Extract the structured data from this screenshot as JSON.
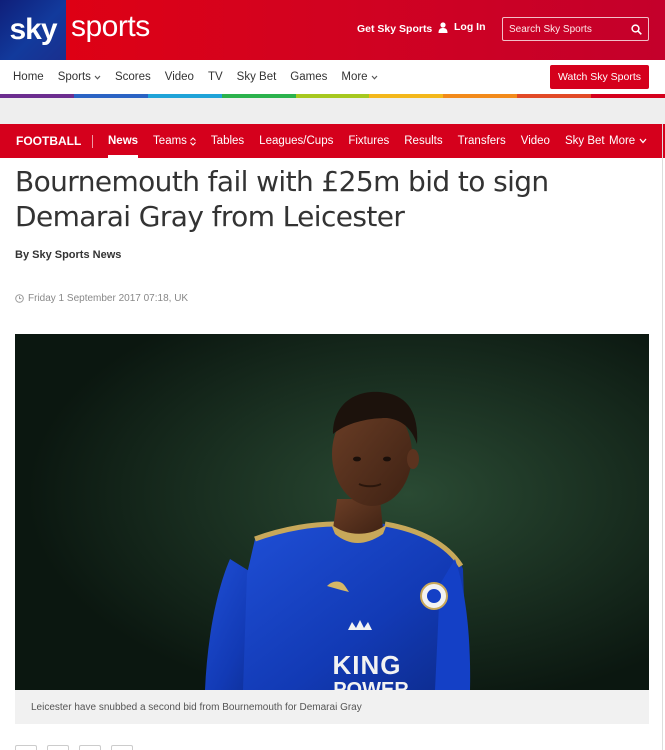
{
  "brand": {
    "logo_text": "sky",
    "section_text": "sports",
    "colors": {
      "red": "#d5001c",
      "blue": "#123a9c"
    }
  },
  "header": {
    "get_sky_label": "Get Sky Sports",
    "login_label": "Log In",
    "search_placeholder": "Search Sky Sports"
  },
  "mainnav": {
    "items": [
      {
        "label": "Home"
      },
      {
        "label": "Sports",
        "dropdown": true
      },
      {
        "label": "Scores"
      },
      {
        "label": "Video"
      },
      {
        "label": "TV"
      },
      {
        "label": "Sky Bet"
      },
      {
        "label": "Games"
      },
      {
        "label": "More",
        "dropdown": true
      }
    ],
    "watch_label": "Watch Sky Sports",
    "rainbow_colors": [
      "#6c2d8f",
      "#2a63c4",
      "#1fa3d8",
      "#2bb24c",
      "#a6c81f",
      "#f3b71b",
      "#f28a1b",
      "#e24a27",
      "#d5001c"
    ]
  },
  "subnav": {
    "section_label": "FOOTBALL",
    "links": [
      {
        "label": "News",
        "active": true
      },
      {
        "label": "Teams",
        "dropdown": true
      },
      {
        "label": "Tables"
      },
      {
        "label": "Leagues/Cups"
      },
      {
        "label": "Fixtures"
      },
      {
        "label": "Results"
      },
      {
        "label": "Transfers"
      },
      {
        "label": "Video"
      },
      {
        "label": "Sky Bet"
      }
    ],
    "more_label": "More"
  },
  "article": {
    "headline_line1": "Bournemouth fail with £25m bid to sign",
    "headline_line2": "Demarai Gray from Leicester",
    "byline": "By Sky Sports News",
    "date": "Friday 1 September 2017 07:18, UK",
    "caption": "Leicester have snubbed a second bid from Bournemouth for Demarai Gray",
    "shirt_sponsor": "KING",
    "shirt_sponsor_line2": "POWER"
  }
}
